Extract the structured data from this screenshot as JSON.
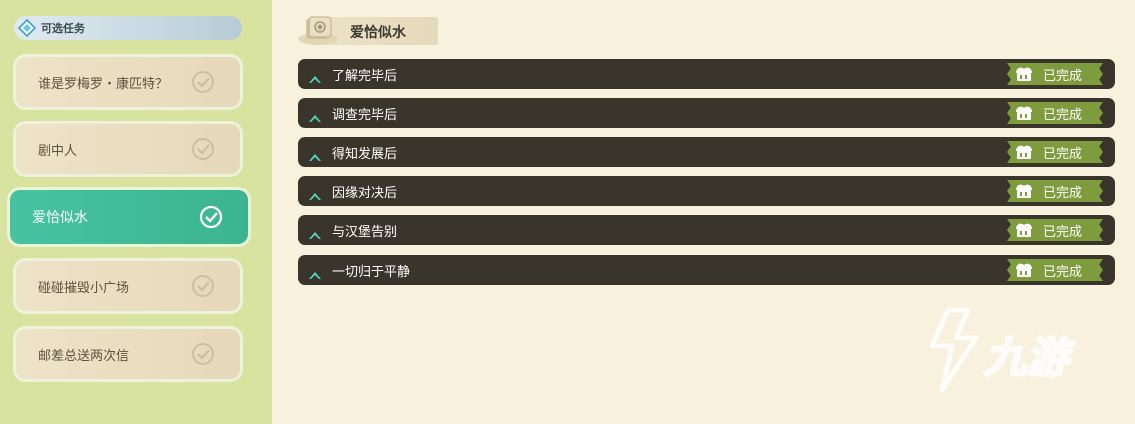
{
  "sidebar": {
    "header_label": "可选任务",
    "quests": [
      {
        "label": "谁是罗梅罗・康匹特？",
        "active": false
      },
      {
        "label": "剧中人",
        "active": false
      },
      {
        "label": "爱恰似水",
        "active": true
      },
      {
        "label": "碰碰摧毁小广场",
        "active": false
      },
      {
        "label": "邮差总送两次信",
        "active": false
      }
    ]
  },
  "main": {
    "title": "爱恰似水",
    "steps": [
      {
        "label": "了解完毕后",
        "status": "已完成"
      },
      {
        "label": "调查完毕后",
        "status": "已完成"
      },
      {
        "label": "得知发展后",
        "status": "已完成"
      },
      {
        "label": "因缘对决后",
        "status": "已完成"
      },
      {
        "label": "与汉堡告别",
        "status": "已完成"
      },
      {
        "label": "一切归于平静",
        "status": "已完成"
      }
    ]
  },
  "watermark": {
    "text": "九游"
  },
  "colors": {
    "sidebar_bg": "#d8e3a0",
    "active_quest": "#46c3a0",
    "step_bg": "#3a352b",
    "done_badge": "#7e9c3e",
    "main_bg": "#f7f1de"
  },
  "icons": {
    "header": "diamond-icon",
    "quest_check": "check-circle-icon",
    "step_arrow": "chevron-up-icon",
    "done_badge": "cake-icon",
    "title": "scroll-icon"
  }
}
